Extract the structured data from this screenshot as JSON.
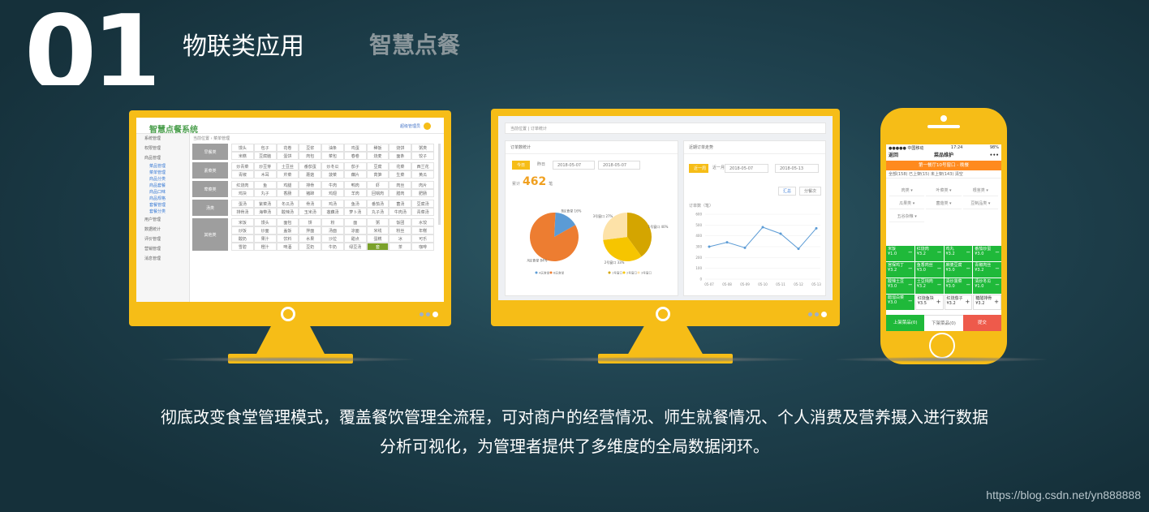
{
  "hero": {
    "number": "01",
    "heading": "物联类应用",
    "subheading": "智慧点餐"
  },
  "caption": {
    "line1": "彻底改变食堂管理模式，覆盖餐饮管理全流程，可对商户的经营情况、师生就餐情况、个人消费及营养摄入进行数据",
    "line2": "分析可视化，为管理者提供了多维度的全局数据闭环。"
  },
  "watermark": "https://blog.csdn.net/yn888888",
  "colors": {
    "bezel": "#f6bd17",
    "accent_green": "#1fb93a",
    "pie_blue": "#5b9bd5",
    "pie_orange": "#ed7d31"
  },
  "monitor1": {
    "logo": "智慧点餐系统",
    "user": "超级管理员",
    "crumb": "当前位置 › 菜单管理",
    "sidebar": [
      "系统管理",
      "权限管理",
      "商品管理",
      "菜品管理",
      "菜单管理",
      "商品分类",
      "商品套餐",
      "商品口味",
      "商品规格",
      "套餐管理",
      "套餐分类",
      "用户管理",
      "数据统计",
      "评价管理",
      "营销管理",
      "消息管理"
    ],
    "groups": [
      {
        "label": "早餐类",
        "rows": 2,
        "cells": [
          "馒头",
          "包子",
          "花卷",
          "豆浆",
          "油条",
          "鸡蛋",
          "稀饭",
          "烧饼",
          "粥类",
          "米糕",
          "豆腐脑",
          "蛋饼",
          "肉包",
          "菜包",
          "春卷",
          "烧麦",
          "面条",
          "饺子"
        ]
      },
      {
        "label": "素菜类",
        "rows": 2,
        "cells": [
          "炒青菜",
          "炒豆芽",
          "土豆丝",
          "番茄蛋",
          "炒冬瓜",
          "茄子",
          "豆腐",
          "花菜",
          "西兰花",
          "青椒",
          "木耳",
          "芹菜",
          "蘑菇",
          "菠菜",
          "藕片",
          "莴笋",
          "生菜",
          "黄瓜"
        ]
      },
      {
        "label": "荤菜类",
        "rows": 2,
        "cells": [
          "红烧肉",
          "鱼",
          "鸡腿",
          "排骨",
          "牛肉",
          "鸭肉",
          "虾",
          "肉丝",
          "肉片",
          "鸡块",
          "丸子",
          "香肠",
          "猪蹄",
          "鸡翅",
          "羊肉",
          "回锅肉",
          "腊肉",
          "肥肠"
        ]
      },
      {
        "label": "汤类",
        "rows": 2,
        "cells": [
          "蛋汤",
          "紫菜汤",
          "冬瓜汤",
          "骨汤",
          "鸡汤",
          "鱼汤",
          "番茄汤",
          "菌汤",
          "豆腐汤",
          "排骨汤",
          "海带汤",
          "酸辣汤",
          "玉米汤",
          "莲藕汤",
          "萝卜汤",
          "丸子汤",
          "牛肉汤",
          "青菜汤"
        ]
      },
      {
        "label": "其他类",
        "rows": 4,
        "cells": [
          "米饭",
          "馒头",
          "面包",
          "饼",
          "粉",
          "面",
          "粥",
          "饭团",
          "水饺",
          "炒饭",
          "炒面",
          "盖饭",
          "拌面",
          "汤面",
          "凉面",
          "米线",
          "粉丝",
          "年糕",
          "酸奶",
          "果汁",
          "饮料",
          "水果",
          "沙拉",
          "甜点",
          "蛋糕",
          "冰",
          "可乐",
          "雪碧",
          "橙汁",
          "啤酒",
          "豆奶",
          "牛奶",
          "绿豆汤",
          "套",
          "茶",
          "咖啡"
        ]
      }
    ]
  },
  "monitor2": {
    "crumb": "当前位置 | 订单统计",
    "left_title": "订单数统计",
    "btn_today": "今日",
    "btn_yesterday": "昨日",
    "date_a": "2018-05-07",
    "date_b": "2018-05-07",
    "total_label": "累计",
    "total_value": "462",
    "total_unit": "笔",
    "right_title": "近期订单走势",
    "btn_week": "近一周",
    "btn_month": "近一月",
    "date_c": "2018-05-07",
    "date_d": "2018-05-13",
    "btn_sum": "汇总",
    "btn_split": "分餐次",
    "ylabel": "订单数（笔）"
  },
  "chart_data": [
    {
      "type": "pie",
      "title": "",
      "series": [
        {
          "name": "B区食堂",
          "value": 16
        },
        {
          "name": "A区食堂",
          "value": 84
        }
      ],
      "labels": [
        "B区食堂 16%",
        "A区食堂 84%"
      ],
      "legend": [
        "A区食堂",
        "B区食堂"
      ]
    },
    {
      "type": "pie",
      "title": "",
      "series": [
        {
          "name": "1号窗口",
          "value": 40
        },
        {
          "name": "2号窗口",
          "value": 33
        },
        {
          "name": "3号窗口",
          "value": 27
        }
      ],
      "labels": [
        "1号窗口 40%",
        "2号窗口 33%",
        "3号窗口 27%"
      ],
      "legend": [
        "1号窗口",
        "2号窗口",
        "3号窗口"
      ]
    },
    {
      "type": "line",
      "title": "",
      "x": [
        "05-07",
        "05-08",
        "05-09",
        "05-10",
        "05-11",
        "05-12",
        "05-13"
      ],
      "y": [
        300,
        340,
        290,
        480,
        420,
        280,
        470
      ],
      "ylim": [
        0,
        600
      ],
      "yticks": [
        "600",
        "500",
        "400",
        "300",
        "200",
        "100",
        "0"
      ]
    }
  ],
  "phone": {
    "status_left": "●●●●● 中国移动",
    "status_time": "17:24",
    "status_right": "98%",
    "back": "返回",
    "title": "菜品维护",
    "more": "•••",
    "store": "第一餐厅10号窗口 - 晚餐",
    "filter": "全部(158)  已上架(15)  未上架(143)  清空",
    "cats": [
      "肉类",
      "叶菜类",
      "根茎类",
      "瓜果类",
      "菌菇类",
      "豆制品类",
      "五谷杂粮"
    ],
    "dishes": [
      {
        "name": "米饭",
        "price": "¥1.0",
        "green": true
      },
      {
        "name": "红烧肉",
        "price": "¥3.2",
        "green": true
      },
      {
        "name": "鸡丸",
        "price": "¥3.2",
        "green": true
      },
      {
        "name": "番茄炒蛋",
        "price": "¥3.0",
        "green": true
      },
      {
        "name": "宫保鸡丁",
        "price": "¥3.2",
        "green": true
      },
      {
        "name": "鱼香肉丝",
        "price": "¥3.0",
        "green": true
      },
      {
        "name": "麻婆豆腐",
        "price": "¥3.0",
        "green": true
      },
      {
        "name": "青椒肉丝",
        "price": "¥3.2",
        "green": true
      },
      {
        "name": "酸辣土豆",
        "price": "¥3.0",
        "green": true
      },
      {
        "name": "土豆炖肉",
        "price": "¥3.2",
        "green": true
      },
      {
        "name": "清炒菠菜",
        "price": "¥3.0",
        "green": true
      },
      {
        "name": "清炒冬瓜",
        "price": "¥1.0",
        "green": true
      },
      {
        "name": "醋溜白菜",
        "price": "¥3.0",
        "green": true
      },
      {
        "name": "红烧鱼块",
        "price": "¥3.5",
        "green": false
      },
      {
        "name": "红烧茄子",
        "price": "¥3.2",
        "green": false
      },
      {
        "name": "糖醋排骨",
        "price": "¥3.2",
        "green": false
      }
    ],
    "footer_up": "上架菜品(0)",
    "footer_down": "下架菜品(0)",
    "footer_submit": "提交"
  }
}
